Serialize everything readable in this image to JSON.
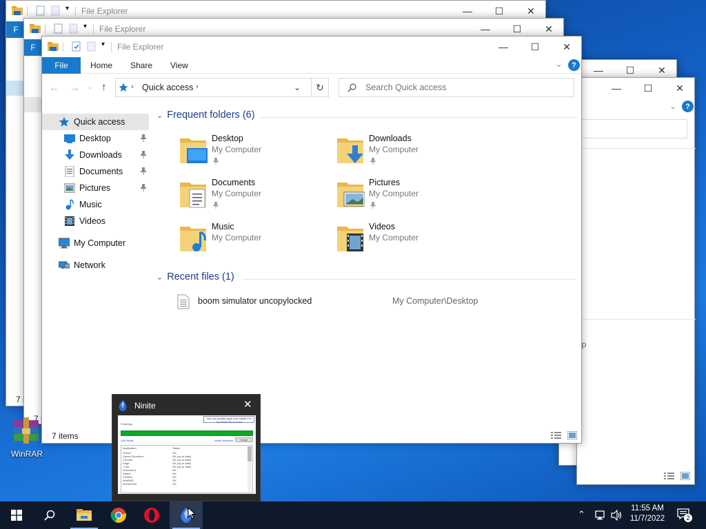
{
  "explorer": {
    "title": "File Explorer",
    "tabs": {
      "file": "File",
      "home": "Home",
      "share": "Share",
      "view": "View"
    },
    "address": {
      "location": "Quick access"
    },
    "search": {
      "placeholder": "Search Quick access"
    },
    "nav": {
      "quick_access": "Quick access",
      "items": [
        "Desktop",
        "Downloads",
        "Documents",
        "Pictures",
        "Music",
        "Videos"
      ],
      "my_computer": "My Computer",
      "network": "Network"
    },
    "frequent": {
      "header": "Frequent folders (6)",
      "folders": [
        {
          "name": "Desktop",
          "location": "My Computer"
        },
        {
          "name": "Downloads",
          "location": "My Computer"
        },
        {
          "name": "Documents",
          "location": "My Computer"
        },
        {
          "name": "Pictures",
          "location": "My Computer"
        },
        {
          "name": "Music",
          "location": "My Computer"
        },
        {
          "name": "Videos",
          "location": "My Computer"
        }
      ]
    },
    "recent": {
      "header": "Recent files (1)",
      "files": [
        {
          "name": "boom simulator uncopylocked",
          "path": "My Computer\\Desktop"
        }
      ]
    },
    "status": {
      "item_count": "7 items"
    }
  },
  "background_windows": {
    "title": "File Explorer",
    "tab_letter": "F",
    "item_count_partial": "7 i",
    "path_fragment": "op"
  },
  "desktop": {
    "winrar_label": "WinRAR"
  },
  "ninite": {
    "title": "Ninite",
    "thumb": {
      "banner": "You can update apps over Ninite Pro",
      "banner_link": "Try Ninite Pro for free",
      "status": "Finishing...",
      "quit_link": "Quit Ninite",
      "feedback_link": "Ninite feedback",
      "close_btn": "Close",
      "col_app": "Application",
      "col_status": "Status",
      "rows": [
        {
          "app": "Firefox",
          "status": "OK"
        },
        {
          "app": "Opera Chromium",
          "status": "OK (up to date)"
        },
        {
          "app": "Chrome",
          "status": "OK (up to date)"
        },
        {
          "app": "Edge",
          "status": "OK (up to date)"
        },
        {
          "app": "7-Zip",
          "status": "OK (up to date)"
        },
        {
          "app": "Greenshot",
          "status": "OK"
        },
        {
          "app": "Steam",
          "status": "OK"
        },
        {
          "app": "XnView",
          "status": "OK"
        },
        {
          "app": "WinRAR",
          "status": "OK"
        },
        {
          "app": "foobar2000",
          "status": "OK"
        }
      ]
    }
  },
  "taskbar": {
    "time": "11:55 AM",
    "date": "11/7/2022",
    "notification_count": "2"
  },
  "colors": {
    "accent": "#1979ca",
    "section_header": "#1e3a8a",
    "taskbar": "#0e1a2b",
    "ninite_progress": "#0ea829"
  }
}
